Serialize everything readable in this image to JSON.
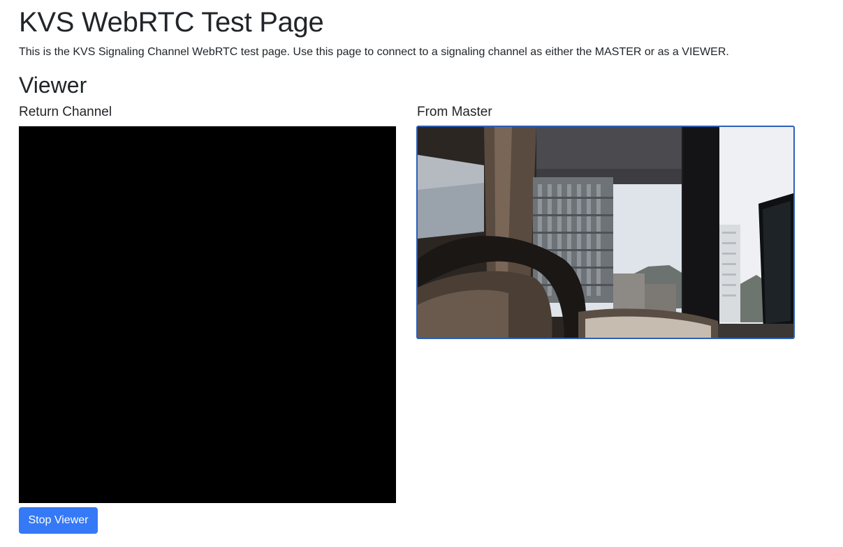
{
  "header": {
    "title": "KVS WebRTC Test Page",
    "description": "This is the KVS Signaling Channel WebRTC test page. Use this page to connect to a signaling channel as either the MASTER or as a VIEWER."
  },
  "viewer": {
    "heading": "Viewer",
    "return_channel_label": "Return Channel",
    "from_master_label": "From Master",
    "stop_button_label": "Stop Viewer"
  },
  "colors": {
    "button_bg": "#3579f6",
    "remote_video_border": "#2c5fb8",
    "local_video_bg": "#000000"
  }
}
